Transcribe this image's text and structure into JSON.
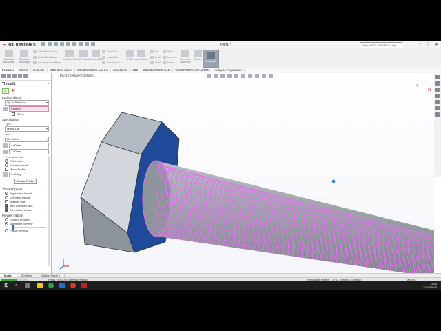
{
  "app": {
    "brand": "SOLIDWORKS",
    "document_title": "Part1 *",
    "search_placeholder": "Search SOLIDWORKS Help"
  },
  "window_controls": {
    "minimize": "−",
    "maximize": "□",
    "close": "✕"
  },
  "ribbon": {
    "items": [
      "Extruded Boss/Base",
      "Revolved Boss/Base",
      "Swept Boss/Base",
      "Lofted Boss/Base",
      "Boundary Boss/Base",
      "Extruded Cut",
      "Hole Wizard",
      "Revolved Cut",
      "Swept Cut",
      "Lofted Cut",
      "Boundary Cut",
      "Fillet",
      "Linear Pattern",
      "Rib",
      "Draft",
      "Shell",
      "Wrap",
      "Intersect",
      "Mirror",
      "Reference Geometry",
      "Curves"
    ],
    "instant3d": "Instant3D"
  },
  "tabs": [
    "Features",
    "Sketch",
    "Evaluate",
    "MBD Dimensions",
    "SOLIDWORKS Add-Ins",
    "Simulation",
    "MBD",
    "SOLIDWORKS CAM",
    "SOLIDWORKS CAM TBM",
    "Analysis Preparation"
  ],
  "panel": {
    "title": "Thread1",
    "help": "?",
    "ok": "✓",
    "cancel": "✕",
    "end_condition": {
      "header": "End Condition",
      "value": "Up To Selection",
      "face": "Face<1>",
      "offset": "Offset"
    },
    "specification": {
      "header": "Specification",
      "type_label": "Type:",
      "type_value": "Metric Die",
      "size_label": "Size:",
      "size_value": "M4.0x1.5",
      "diameter": "4.00mm",
      "pitch": "1.50mm",
      "thread_method_label": "Thread method:",
      "cut_thread": "Cut thread",
      "extrude_thread": "Extrude thread",
      "mirror_profile": "Mirror Profile",
      "rotation": "0.00deg",
      "locate_profile": "Locate Profile"
    },
    "thread_options": {
      "header": "Thread Options",
      "right_hand": "Right-hand thread",
      "left_hand": "Left-hand thread",
      "multiple_start": "Multiple Start",
      "trim_start": "Trim with start face",
      "trim_end": "Trim with end face"
    },
    "preview_options": {
      "header": "Preview Options",
      "shaded": "Shaded preview",
      "wireframe": "Wireframe preview",
      "partial": "Partial preview"
    }
  },
  "viewport": {
    "breadcrumb": "Part1 (Default<<Default>..."
  },
  "model_tabs": [
    "Model",
    "3D Views",
    "Motion Study 1"
  ],
  "status": {
    "progress": 0.6,
    "message": "Press <ESC> to interrupt rebuild",
    "rebuild": "Rebuilding feature 1 of 1 - Thread1 (Default)",
    "units": "MMGS"
  },
  "taskbar": {
    "start": "⊞",
    "search": "⌕",
    "time": "13:50",
    "date": "12/05/2020"
  },
  "colors": {
    "thread": "#e46ff0",
    "hex_face": "#1f4a9a",
    "accent": "#2a6ac0"
  }
}
